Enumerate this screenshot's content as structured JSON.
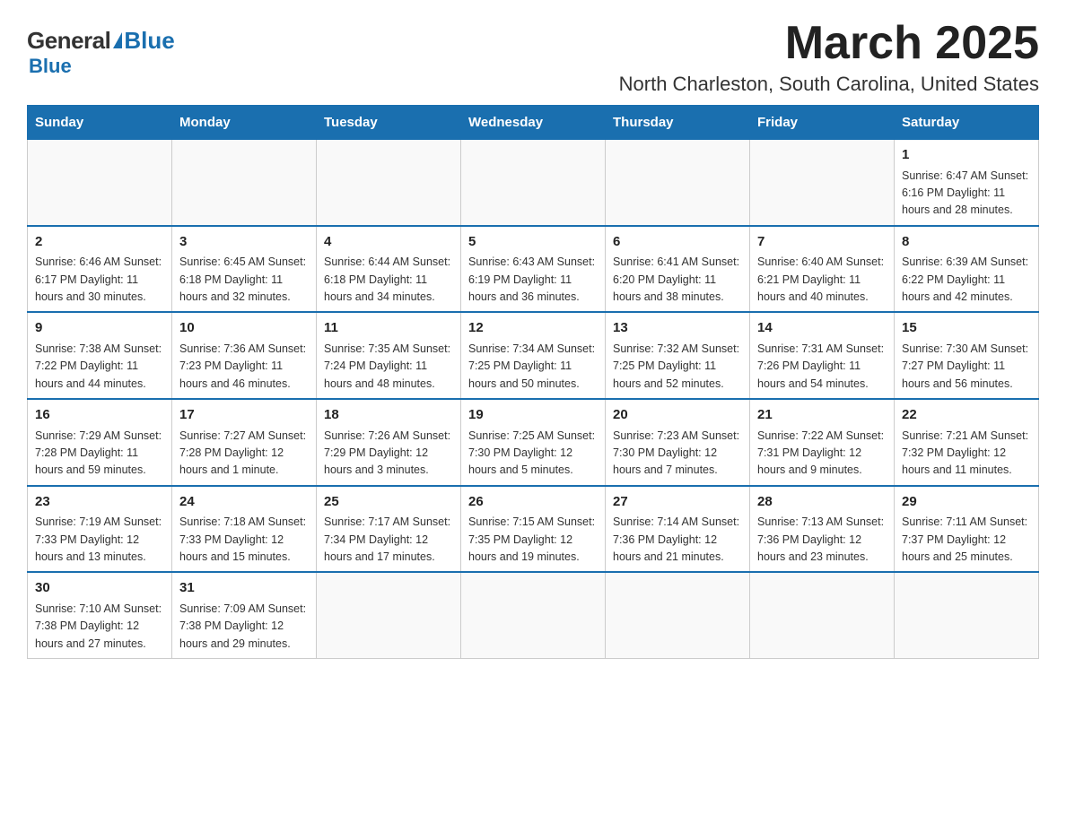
{
  "logo": {
    "general": "General",
    "blue": "Blue"
  },
  "title": "March 2025",
  "location": "North Charleston, South Carolina, United States",
  "weekdays": [
    "Sunday",
    "Monday",
    "Tuesday",
    "Wednesday",
    "Thursday",
    "Friday",
    "Saturday"
  ],
  "weeks": [
    [
      {
        "day": "",
        "info": ""
      },
      {
        "day": "",
        "info": ""
      },
      {
        "day": "",
        "info": ""
      },
      {
        "day": "",
        "info": ""
      },
      {
        "day": "",
        "info": ""
      },
      {
        "day": "",
        "info": ""
      },
      {
        "day": "1",
        "info": "Sunrise: 6:47 AM\nSunset: 6:16 PM\nDaylight: 11 hours\nand 28 minutes."
      }
    ],
    [
      {
        "day": "2",
        "info": "Sunrise: 6:46 AM\nSunset: 6:17 PM\nDaylight: 11 hours\nand 30 minutes."
      },
      {
        "day": "3",
        "info": "Sunrise: 6:45 AM\nSunset: 6:18 PM\nDaylight: 11 hours\nand 32 minutes."
      },
      {
        "day": "4",
        "info": "Sunrise: 6:44 AM\nSunset: 6:18 PM\nDaylight: 11 hours\nand 34 minutes."
      },
      {
        "day": "5",
        "info": "Sunrise: 6:43 AM\nSunset: 6:19 PM\nDaylight: 11 hours\nand 36 minutes."
      },
      {
        "day": "6",
        "info": "Sunrise: 6:41 AM\nSunset: 6:20 PM\nDaylight: 11 hours\nand 38 minutes."
      },
      {
        "day": "7",
        "info": "Sunrise: 6:40 AM\nSunset: 6:21 PM\nDaylight: 11 hours\nand 40 minutes."
      },
      {
        "day": "8",
        "info": "Sunrise: 6:39 AM\nSunset: 6:22 PM\nDaylight: 11 hours\nand 42 minutes."
      }
    ],
    [
      {
        "day": "9",
        "info": "Sunrise: 7:38 AM\nSunset: 7:22 PM\nDaylight: 11 hours\nand 44 minutes."
      },
      {
        "day": "10",
        "info": "Sunrise: 7:36 AM\nSunset: 7:23 PM\nDaylight: 11 hours\nand 46 minutes."
      },
      {
        "day": "11",
        "info": "Sunrise: 7:35 AM\nSunset: 7:24 PM\nDaylight: 11 hours\nand 48 minutes."
      },
      {
        "day": "12",
        "info": "Sunrise: 7:34 AM\nSunset: 7:25 PM\nDaylight: 11 hours\nand 50 minutes."
      },
      {
        "day": "13",
        "info": "Sunrise: 7:32 AM\nSunset: 7:25 PM\nDaylight: 11 hours\nand 52 minutes."
      },
      {
        "day": "14",
        "info": "Sunrise: 7:31 AM\nSunset: 7:26 PM\nDaylight: 11 hours\nand 54 minutes."
      },
      {
        "day": "15",
        "info": "Sunrise: 7:30 AM\nSunset: 7:27 PM\nDaylight: 11 hours\nand 56 minutes."
      }
    ],
    [
      {
        "day": "16",
        "info": "Sunrise: 7:29 AM\nSunset: 7:28 PM\nDaylight: 11 hours\nand 59 minutes."
      },
      {
        "day": "17",
        "info": "Sunrise: 7:27 AM\nSunset: 7:28 PM\nDaylight: 12 hours\nand 1 minute."
      },
      {
        "day": "18",
        "info": "Sunrise: 7:26 AM\nSunset: 7:29 PM\nDaylight: 12 hours\nand 3 minutes."
      },
      {
        "day": "19",
        "info": "Sunrise: 7:25 AM\nSunset: 7:30 PM\nDaylight: 12 hours\nand 5 minutes."
      },
      {
        "day": "20",
        "info": "Sunrise: 7:23 AM\nSunset: 7:30 PM\nDaylight: 12 hours\nand 7 minutes."
      },
      {
        "day": "21",
        "info": "Sunrise: 7:22 AM\nSunset: 7:31 PM\nDaylight: 12 hours\nand 9 minutes."
      },
      {
        "day": "22",
        "info": "Sunrise: 7:21 AM\nSunset: 7:32 PM\nDaylight: 12 hours\nand 11 minutes."
      }
    ],
    [
      {
        "day": "23",
        "info": "Sunrise: 7:19 AM\nSunset: 7:33 PM\nDaylight: 12 hours\nand 13 minutes."
      },
      {
        "day": "24",
        "info": "Sunrise: 7:18 AM\nSunset: 7:33 PM\nDaylight: 12 hours\nand 15 minutes."
      },
      {
        "day": "25",
        "info": "Sunrise: 7:17 AM\nSunset: 7:34 PM\nDaylight: 12 hours\nand 17 minutes."
      },
      {
        "day": "26",
        "info": "Sunrise: 7:15 AM\nSunset: 7:35 PM\nDaylight: 12 hours\nand 19 minutes."
      },
      {
        "day": "27",
        "info": "Sunrise: 7:14 AM\nSunset: 7:36 PM\nDaylight: 12 hours\nand 21 minutes."
      },
      {
        "day": "28",
        "info": "Sunrise: 7:13 AM\nSunset: 7:36 PM\nDaylight: 12 hours\nand 23 minutes."
      },
      {
        "day": "29",
        "info": "Sunrise: 7:11 AM\nSunset: 7:37 PM\nDaylight: 12 hours\nand 25 minutes."
      }
    ],
    [
      {
        "day": "30",
        "info": "Sunrise: 7:10 AM\nSunset: 7:38 PM\nDaylight: 12 hours\nand 27 minutes."
      },
      {
        "day": "31",
        "info": "Sunrise: 7:09 AM\nSunset: 7:38 PM\nDaylight: 12 hours\nand 29 minutes."
      },
      {
        "day": "",
        "info": ""
      },
      {
        "day": "",
        "info": ""
      },
      {
        "day": "",
        "info": ""
      },
      {
        "day": "",
        "info": ""
      },
      {
        "day": "",
        "info": ""
      }
    ]
  ]
}
